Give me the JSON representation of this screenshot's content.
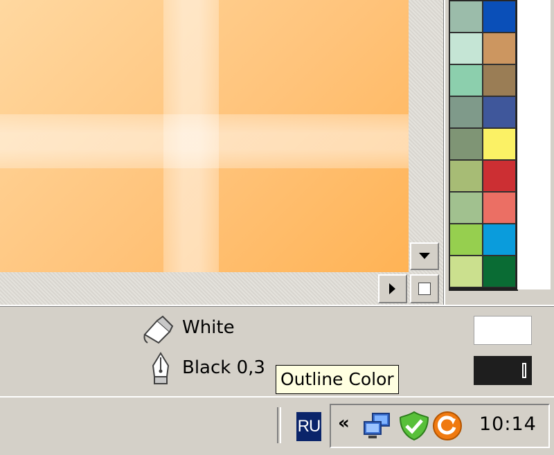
{
  "status": {
    "fill_label": "White",
    "outline_label": "Black  0,3",
    "fill_color": "#ffffff",
    "outline_color": "#1e1e1e"
  },
  "tooltip": {
    "text": "Outline Color"
  },
  "palette": {
    "colors": [
      "#9bbcaa",
      "#0a4fb8",
      "#c5e5d5",
      "#cc9660",
      "#8ccfad",
      "#9a7d55",
      "#7f9a8a",
      "#3f579b",
      "#7f9575",
      "#fbf165",
      "#a7bc75",
      "#cc2f33",
      "#a1c18f",
      "#eb6f64",
      "#96cf4f",
      "#0a9cdc",
      "#cbe08e",
      "#0a6c34"
    ]
  },
  "taskbar": {
    "language": "RU",
    "chevron": "«",
    "clock": "10:14",
    "tray_icons": [
      "network-icon",
      "shield-icon",
      "update-icon"
    ]
  }
}
